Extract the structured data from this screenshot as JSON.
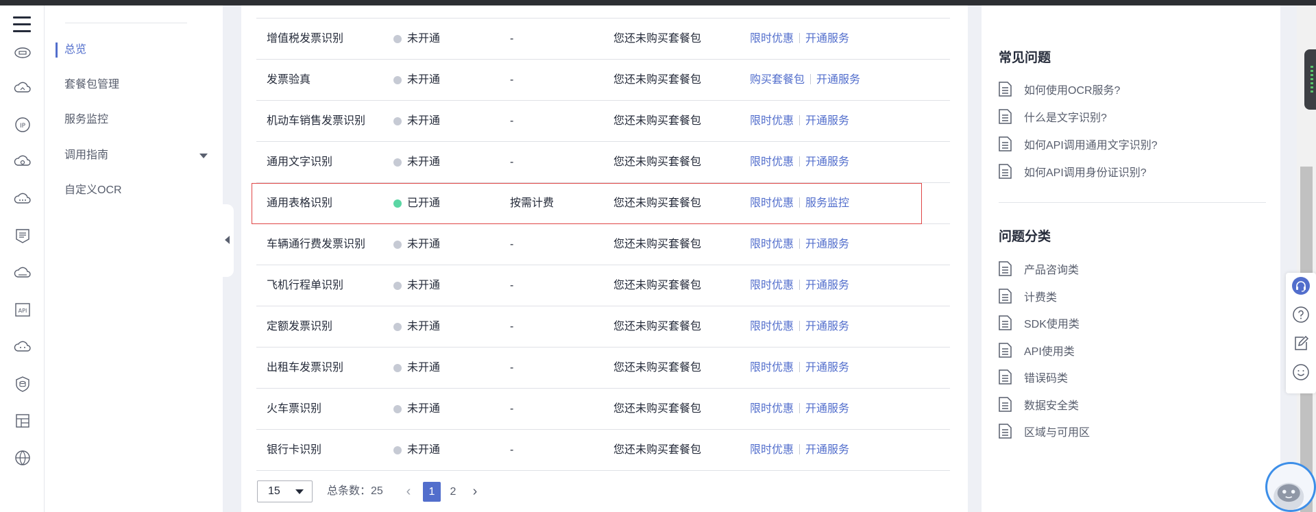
{
  "nav": {
    "items": [
      {
        "label": "总览",
        "active": true
      },
      {
        "label": "套餐包管理"
      },
      {
        "label": "服务监控"
      },
      {
        "label": "调用指南",
        "expandable": true
      },
      {
        "label": "自定义OCR"
      }
    ]
  },
  "rail_icons": [
    "cloud-server-icon",
    "cloud-sync-icon",
    "ip-icon",
    "cloud-settings-icon",
    "cloud-more-icon",
    "shield-list-icon",
    "cloud-icon",
    "api-icon",
    "cloud-dots-icon",
    "database-shield-icon",
    "layout-icon",
    "globe-icon"
  ],
  "services": [
    {
      "name": "增值税发票识别",
      "status": "未开通",
      "enabled": false,
      "billing": "-",
      "package": "您还未购买套餐包",
      "op1": "限时优惠",
      "op2": "开通服务"
    },
    {
      "name": "发票验真",
      "status": "未开通",
      "enabled": false,
      "billing": "-",
      "package": "您还未购买套餐包",
      "op1": "购买套餐包",
      "op2": "开通服务"
    },
    {
      "name": "机动车销售发票识别",
      "status": "未开通",
      "enabled": false,
      "billing": "-",
      "package": "您还未购买套餐包",
      "op1": "限时优惠",
      "op2": "开通服务"
    },
    {
      "name": "通用文字识别",
      "status": "未开通",
      "enabled": false,
      "billing": "-",
      "package": "您还未购买套餐包",
      "op1": "限时优惠",
      "op2": "开通服务"
    },
    {
      "name": "通用表格识别",
      "status": "已开通",
      "enabled": true,
      "billing": "按需计费",
      "package": "您还未购买套餐包",
      "op1": "限时优惠",
      "op2": "服务监控"
    },
    {
      "name": "车辆通行费发票识别",
      "status": "未开通",
      "enabled": false,
      "billing": "-",
      "package": "您还未购买套餐包",
      "op1": "限时优惠",
      "op2": "开通服务"
    },
    {
      "name": "飞机行程单识别",
      "status": "未开通",
      "enabled": false,
      "billing": "-",
      "package": "您还未购买套餐包",
      "op1": "限时优惠",
      "op2": "开通服务"
    },
    {
      "name": "定额发票识别",
      "status": "未开通",
      "enabled": false,
      "billing": "-",
      "package": "您还未购买套餐包",
      "op1": "限时优惠",
      "op2": "开通服务"
    },
    {
      "name": "出租车发票识别",
      "status": "未开通",
      "enabled": false,
      "billing": "-",
      "package": "您还未购买套餐包",
      "op1": "限时优惠",
      "op2": "开通服务"
    },
    {
      "name": "火车票识别",
      "status": "未开通",
      "enabled": false,
      "billing": "-",
      "package": "您还未购买套餐包",
      "op1": "限时优惠",
      "op2": "开通服务"
    },
    {
      "name": "银行卡识别",
      "status": "未开通",
      "enabled": false,
      "billing": "-",
      "package": "您还未购买套餐包",
      "op1": "限时优惠",
      "op2": "开通服务"
    }
  ],
  "pagination": {
    "page_size": "15",
    "total_label": "总条数：25",
    "pages": [
      "1",
      "2"
    ],
    "current_page": "1"
  },
  "faq": {
    "title": "常见问题",
    "items": [
      "如何使用OCR服务?",
      "什么是文字识别?",
      "如何API调用通用文字识别?",
      "如何API调用身份证识别?"
    ]
  },
  "categories": {
    "title": "问题分类",
    "items": [
      "产品咨询类",
      "计费类",
      "SDK使用类",
      "API使用类",
      "错误码类",
      "数据安全类",
      "区域与可用区"
    ]
  },
  "float_tools": [
    "headset-icon",
    "help-icon",
    "feedback-icon",
    "smile-icon"
  ],
  "colors": {
    "link": "#526ecc",
    "enabled_dot": "#5bd6a4",
    "disabled_dot": "#c6cad4",
    "highlight_border": "#e04545"
  }
}
